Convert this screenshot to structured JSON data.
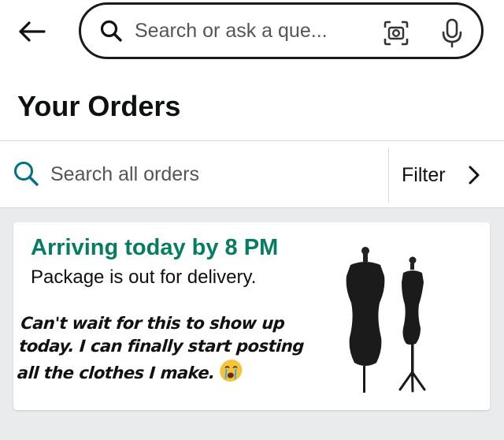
{
  "search": {
    "placeholder": "Search or ask a que..."
  },
  "page": {
    "title": "Your Orders"
  },
  "orders_search": {
    "placeholder": "Search all orders",
    "filter_label": "Filter"
  },
  "order": {
    "arrival": "Arriving today by 8 PM",
    "status": "Package is out for delivery."
  },
  "overlay_caption": {
    "line1": "Can't wait for this to show up",
    "line2": "today. I can finally start posting",
    "line3": "all the clothes I make."
  },
  "icons": {
    "back": "arrow-left-icon",
    "search": "search-icon",
    "camera": "camera-scan-icon",
    "mic": "microphone-icon",
    "filter_chevron": "chevron-right-icon",
    "emoji": "crying-face-emoji"
  },
  "colors": {
    "accent_teal": "#007185",
    "arrival_green": "#067d62",
    "text": "#0f1111",
    "background": "#e9ebec"
  }
}
